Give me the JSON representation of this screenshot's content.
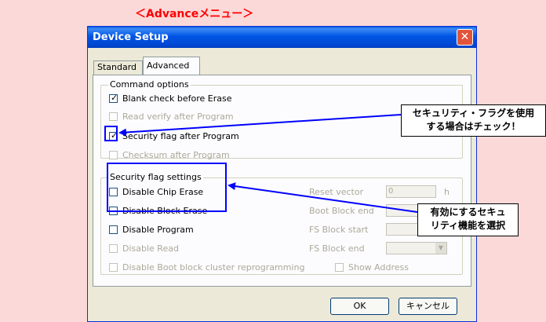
{
  "caption": "＜Advanceメニュー＞",
  "window": {
    "title": "Device Setup",
    "close_glyph": "✕"
  },
  "tabs": {
    "standard": "Standard",
    "advanced": "Advanced"
  },
  "command_options": {
    "title": "Command options",
    "items": [
      {
        "label": "Blank check before Erase",
        "checked": true,
        "enabled": true
      },
      {
        "label": "Read verify after Program",
        "checked": false,
        "enabled": false
      },
      {
        "label": "Security flag after Program",
        "checked": true,
        "enabled": true
      },
      {
        "label": "Checksum after Program",
        "checked": false,
        "enabled": false
      }
    ]
  },
  "security_settings": {
    "title": "Security flag settings",
    "items": [
      {
        "label": "Disable Chip Erase",
        "enabled": true
      },
      {
        "label": "Disable Block Erase",
        "enabled": true
      },
      {
        "label": "Disable Program",
        "enabled": true
      },
      {
        "label": "Disable Read",
        "enabled": false
      },
      {
        "label": "Disable Boot block cluster reprogramming",
        "enabled": false
      }
    ]
  },
  "right_fields": {
    "reset_vector_label": "Reset vector",
    "reset_vector_value": "0",
    "reset_vector_unit": "h",
    "boot_block_end_label": "Boot Block end",
    "fs_block_start_label": "FS Block start",
    "fs_block_end_label": "FS Block end",
    "show_address_label": "Show Address"
  },
  "buttons": {
    "ok": "OK",
    "cancel": "キャンセル"
  },
  "callouts": {
    "top_line1": "セキュリティ・フラグを使用",
    "top_line2": "する場合はチェック！",
    "bottom_line1": "有効にするセキュ",
    "bottom_line2": "リティ機能を選択"
  },
  "colors": {
    "background": "#fcd9d9",
    "caption": "#ff0000",
    "highlight": "#0000ff",
    "titlebar": "#0055e5"
  }
}
